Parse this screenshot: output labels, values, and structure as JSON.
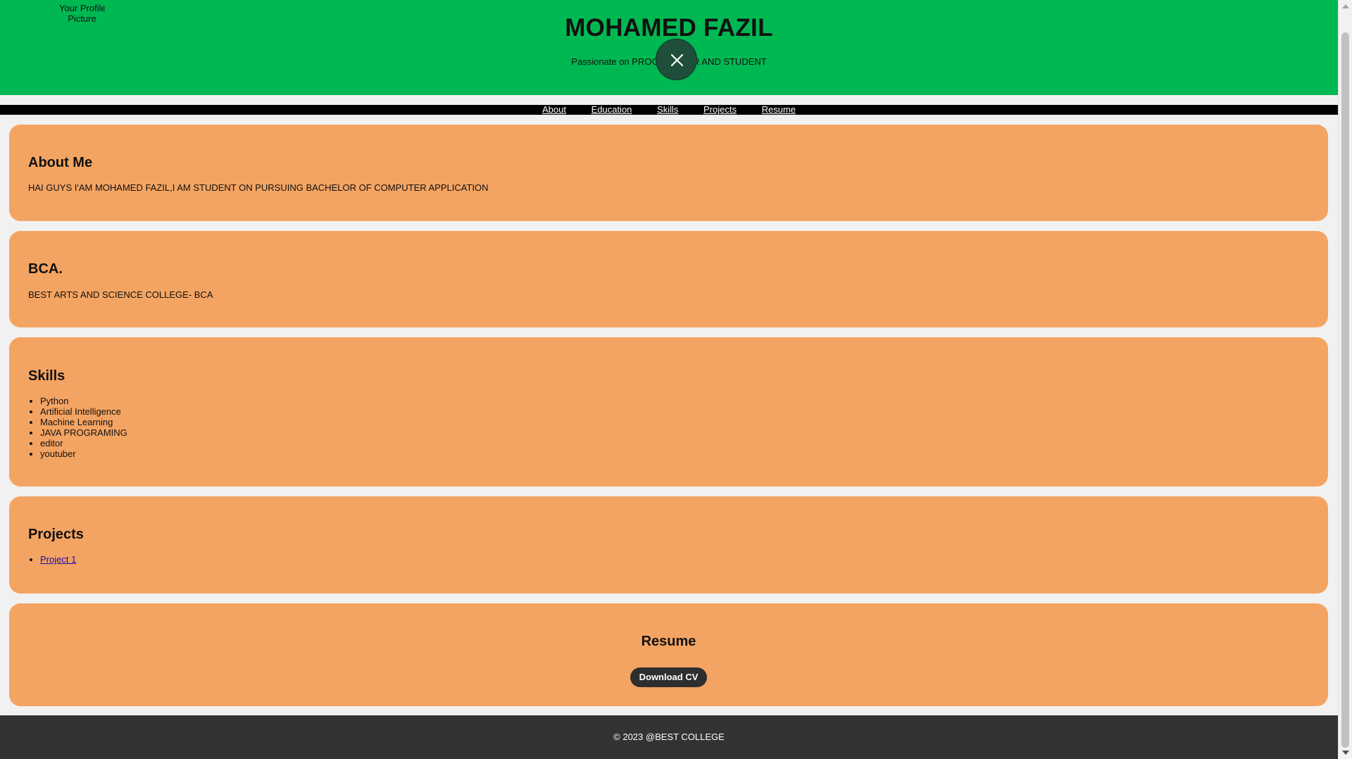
{
  "header": {
    "profile_picture_alt": [
      "Your Profile",
      "Picture"
    ],
    "name": "MOHAMED FAZIL",
    "tagline": "Passionate on PROGRAMMER AND STUDENT"
  },
  "nav": {
    "items": [
      "About",
      "Education",
      "Skills",
      "Projects",
      "Resume"
    ]
  },
  "about": {
    "title": "About Me",
    "text": "HAI GUYS I'AM MOHAMED FAZIL,I AM STUDENT ON PURSUING BACHELOR OF COMPUTER APPLICATION"
  },
  "education": {
    "title": "BCA.",
    "text": "BEST ARTS AND SCIENCE COLLEGE- BCA"
  },
  "skills": {
    "title": "Skills",
    "items": [
      "Python",
      "Artificial Intelligence",
      "Machine Learning",
      "JAVA PROGRAMING",
      "editor",
      "youtuber"
    ]
  },
  "projects": {
    "title": "Projects",
    "items": [
      "Project 1"
    ]
  },
  "resume": {
    "title": "Resume",
    "button_label": "Download CV"
  },
  "footer": {
    "text": "© 2023 @BEST COLLEGE"
  },
  "colors": {
    "header_bg": "#00b852",
    "card_bg": "#f4a462",
    "nav_bg": "#000000",
    "footer_bg": "#333333",
    "button_bg": "#2e2e2e"
  },
  "icons": {
    "overlay_close": "close-icon"
  }
}
